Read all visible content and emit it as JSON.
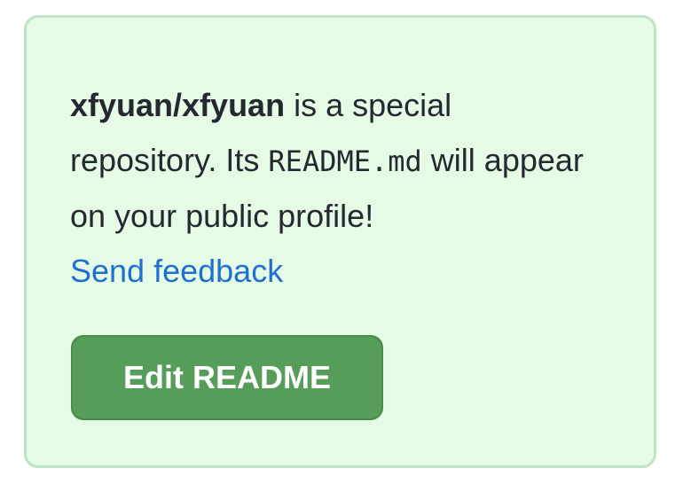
{
  "notice": {
    "repo_name": "xfyuan/xfyuan",
    "text_part1": " is a special repository. Its ",
    "code_text": "README.md",
    "text_part2": " will appear on your public profile!",
    "feedback_link": "Send feedback"
  },
  "edit_button": {
    "label": "Edit README"
  },
  "colors": {
    "card_background": "#e5fbe5",
    "card_border": "#bfe3c6",
    "button_background": "#559d58",
    "link": "#1f6fd0",
    "text": "#24292f"
  }
}
